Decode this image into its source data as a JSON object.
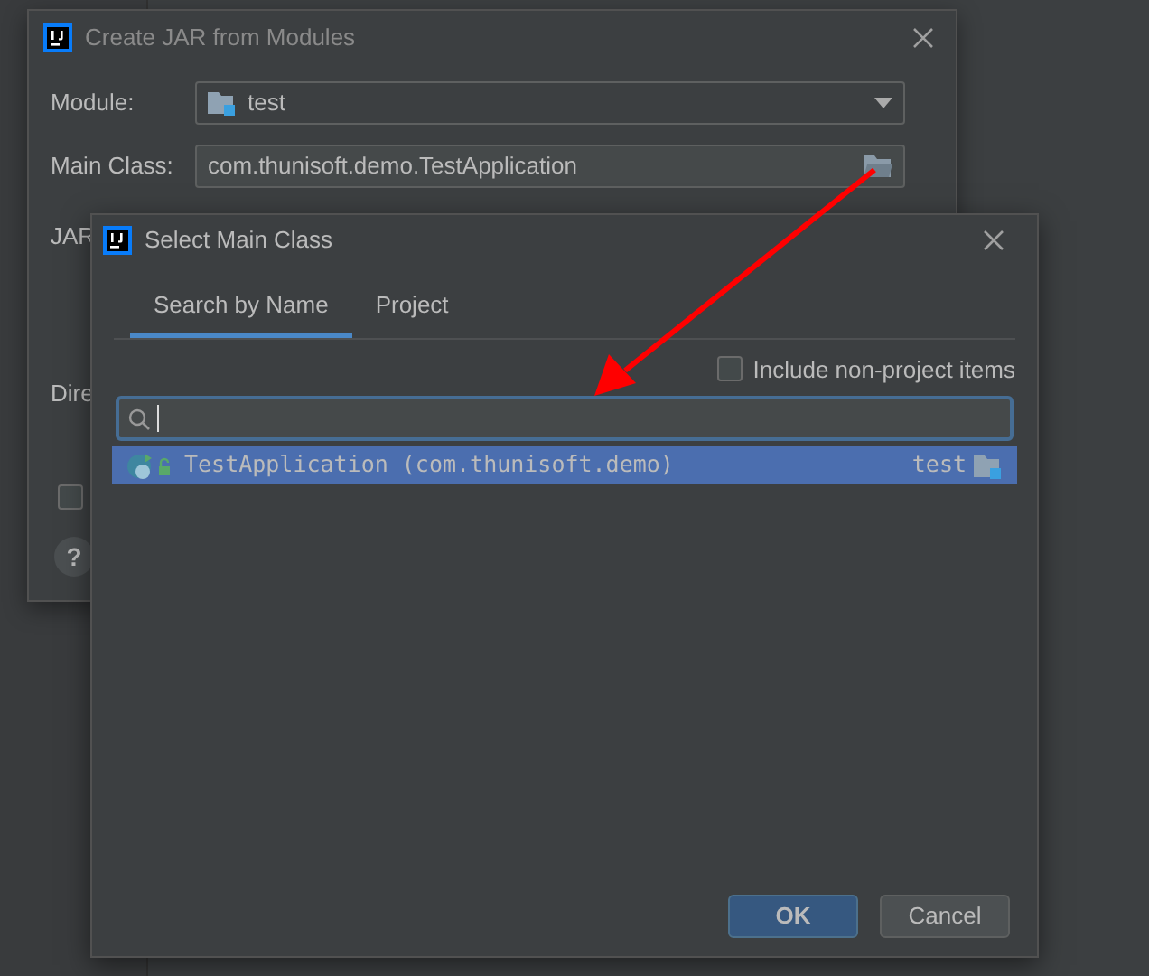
{
  "back_dialog": {
    "title": "Create JAR from Modules",
    "module": {
      "label": "Module:",
      "value": "test"
    },
    "main_class": {
      "label": "Main Class:",
      "value": "com.thunisoft.demo.TestApplication"
    },
    "partial_labels": [
      "JAR",
      "Dire"
    ],
    "checkbox": {
      "checked": false
    },
    "help": "?"
  },
  "front_dialog": {
    "title": "Select Main Class",
    "tabs": [
      {
        "label": "Search by Name",
        "selected": true
      },
      {
        "label": "Project",
        "selected": false
      }
    ],
    "include_non_project": {
      "label": "Include non-project items",
      "checked": false
    },
    "search": {
      "focused": true
    },
    "results": [
      {
        "name": "TestApplication (com.thunisoft.demo)",
        "module": "test",
        "selected": true
      }
    ],
    "buttons": [
      {
        "label": "OK",
        "kind": "primary"
      },
      {
        "label": "Cancel",
        "kind": "secondary"
      }
    ]
  }
}
